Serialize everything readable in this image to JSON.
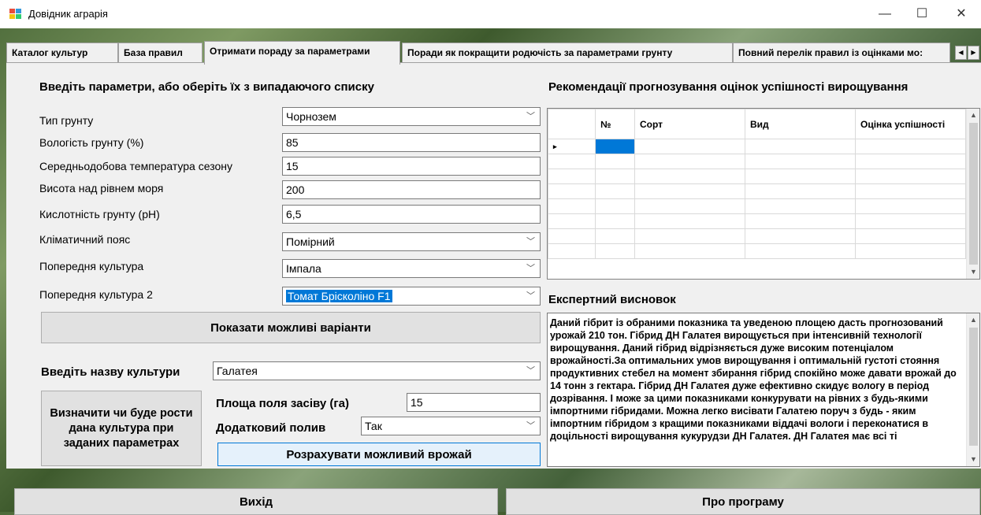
{
  "window": {
    "title": "Довідник аграрія",
    "minimize": "—",
    "maximize": "☐",
    "close": "✕"
  },
  "tabs": [
    {
      "label": "Каталог культур"
    },
    {
      "label": "База правил"
    },
    {
      "label": "Отримати пораду за параметрами"
    },
    {
      "label": "Поради як покращити родючість за параметрами грунту"
    },
    {
      "label": "Повний перелік правил із оцінками мо:"
    }
  ],
  "tab_scroll": {
    "left": "◀",
    "right": "▶"
  },
  "left": {
    "heading": "Введіть параметри, або оберіть їх з випадаючого списку",
    "fields": [
      {
        "label": "Тип грунту",
        "value": "Чорнозем"
      },
      {
        "label": "Вологість грунту (%)",
        "value": "85"
      },
      {
        "label": "Середньодобова температура сезону",
        "value": "15"
      },
      {
        "label": "Висота над рівнем моря",
        "value": "200"
      },
      {
        "label": "Кислотність грунту (pH)",
        "value": "6,5"
      },
      {
        "label": "Кліматичний пояс",
        "value": "Помірний"
      },
      {
        "label": "Попередня культура",
        "value": "Імпала"
      },
      {
        "label": "Попередня культура 2",
        "value": "Томат Брісколіно F1"
      }
    ],
    "show_button": "Показати можливі варіанти",
    "culture_label": "Введіть назву культури",
    "culture_value": "Галатея",
    "determine_button": "Визначити чи буде рости дана культура при заданих параметрах",
    "area_label": "Площа поля засіву (га)",
    "area_value": "15",
    "irrigation_label": "Додатковий полив",
    "irrigation_value": "Так",
    "calc_button": "Розрахувати можливий врожай"
  },
  "right": {
    "heading": "Рекомендації прогнозування оцінок успішності вирощування",
    "columns": [
      "№",
      "Сорт",
      "Вид",
      "Оцінка успішності"
    ],
    "conclusion_heading": "Експертний висновок",
    "conclusion_text": "Даний гібрит із обраними показника та уведеною площею дасть прогнозований урожай 210 тон. Гібрид ДН Галатея вирощується при інтенсивній технології вирощування. Даний гібрид відрізняється дуже високим потенціалом врожайності.За оптимальних умов вирощування і оптимальній густоті стояння продуктивних стебел на момент збирання гібрид спокійно може давати врожай до 14 тонн з гектара. Гібрид ДН Галатея дуже ефективно скидує вологу в період дозрівання. І може за цими показниками конкурувати на рівних з будь-якими імпортними гібридами. Можна легко висівати Галатею поруч з будь - яким імпортним гібридом з кращими показниками віддачі вологи і переконатися в доцільності вирощування кукурудзи ДН Галатея. ДН Галатея має всі ті"
  },
  "bottom": {
    "exit": "Вихід",
    "about": "Про програму"
  },
  "icons": {
    "chevron": "﹀",
    "row_pointer": "▸",
    "scroll_up": "▲",
    "scroll_down": "▼"
  },
  "colors": {
    "accent": "#0078d7",
    "panel": "#f0f0f0"
  }
}
